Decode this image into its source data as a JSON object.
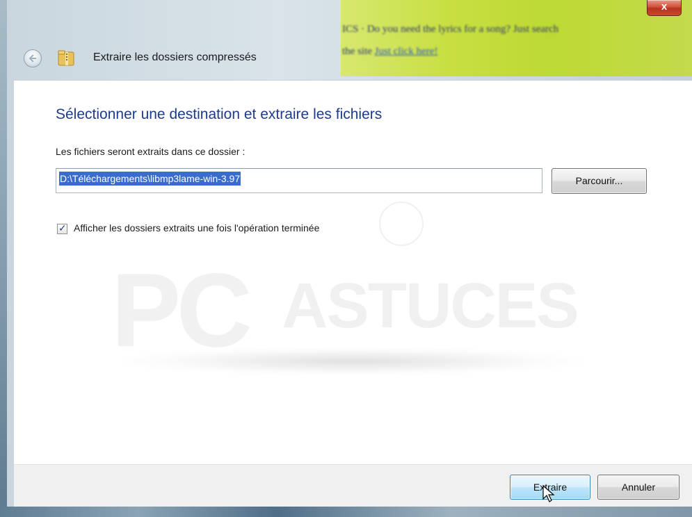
{
  "window": {
    "title": "Extraire les dossiers compressés",
    "close_label": "x"
  },
  "background_peek": {
    "line1": "ICS · Do you need the lyrics for a song? Just search",
    "line2_prefix": "the site",
    "line2_link": "Just click here!"
  },
  "watermark": {
    "brand_pc": "PC",
    "brand_astuces": "ASTUCES"
  },
  "dialog": {
    "heading": "Sélectionner une destination et extraire les fichiers",
    "field_label": "Les fichiers seront extraits dans ce dossier :",
    "path_value": "D:\\Téléchargements\\libmp3lame-win-3.97",
    "browse_label": "Parcourir...",
    "checkbox_label": "Afficher les dossiers extraits une fois l'opération terminée",
    "checkbox_checked": true
  },
  "footer": {
    "extract_label": "Extraire",
    "cancel_label": "Annuler"
  },
  "icons": {
    "back": "back-arrow-icon",
    "zip": "zip-folder-icon",
    "cursor": "mouse-pointer-icon"
  }
}
